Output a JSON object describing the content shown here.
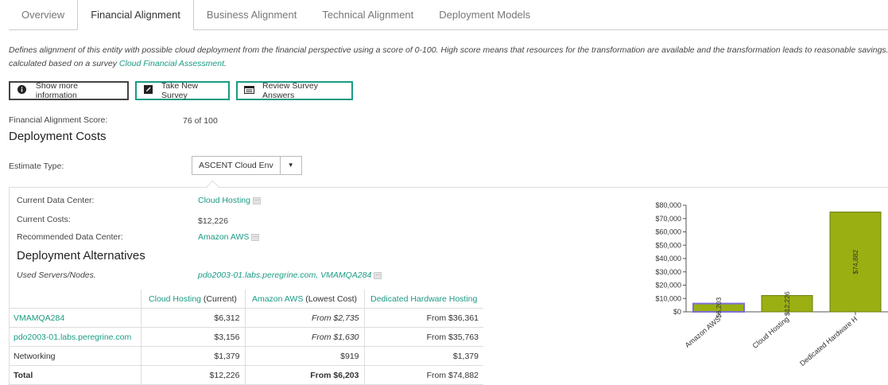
{
  "tabs": [
    {
      "label": "Overview",
      "active": false
    },
    {
      "label": "Financial Alignment",
      "active": true
    },
    {
      "label": "Business Alignment",
      "active": false
    },
    {
      "label": "Technical Alignment",
      "active": false
    },
    {
      "label": "Deployment Models",
      "active": false
    }
  ],
  "description": {
    "line1": "Defines alignment of this entity with possible cloud deployment from the financial perspective using a score of 0-100. High score means that resources for the transformation are available and the transformation leads to reasonable savings.",
    "line2_prefix": "calculated based on a survey ",
    "line2_link": "Cloud Financial Assessment",
    "line2_suffix": "."
  },
  "buttons": {
    "show_more": {
      "label": "Show more information",
      "icon": "info-icon"
    },
    "new_survey": {
      "label": "Take New Survey",
      "icon": "edit-icon"
    },
    "review": {
      "label": "Review Survey Answers",
      "icon": "list-icon"
    }
  },
  "score": {
    "label": "Financial Alignment Score:",
    "value": "76 of 100"
  },
  "deployment_costs": {
    "title": "Deployment Costs"
  },
  "estimate": {
    "label": "Estimate Type:",
    "value": "ASCENT Cloud Env"
  },
  "details": {
    "current_dc_label": "Current Data Center:",
    "current_dc_value": "Cloud Hosting",
    "current_costs_label": "Current Costs:",
    "current_costs_value": "$12,226",
    "recommended_label": "Recommended Data Center:",
    "recommended_value": "Amazon AWS"
  },
  "alternatives": {
    "title": "Deployment Alternatives",
    "used_label": "Used Servers/Nodes.",
    "used_value": "pdo2003-01.labs.peregrine.com, VMAMQA284"
  },
  "table": {
    "headers": [
      {
        "link": "Cloud Hosting",
        "suffix": " (Current)"
      },
      {
        "link": "Amazon AWS",
        "suffix": " (Lowest Cost)"
      },
      {
        "link": "Dedicated Hardware Hosting",
        "suffix": ""
      }
    ],
    "rows": [
      {
        "name": "VMAMQA284",
        "link": true,
        "c1": "$6,312",
        "c2": "From $2,735",
        "c3": "From $36,361"
      },
      {
        "name": "pdo2003-01.labs.peregrine.com",
        "link": true,
        "c1": "$3,156",
        "c2": "From $1,630",
        "c3": "From $35,763"
      },
      {
        "name": "Networking",
        "link": false,
        "c1": "$1,379",
        "c2": "$919",
        "c3": "$1,379"
      },
      {
        "name": "Total",
        "link": false,
        "c1": "$12,226",
        "c2": "From $6,203",
        "c3": "From $74,882"
      }
    ]
  },
  "chart_data": {
    "type": "bar",
    "categories": [
      "Amazon AWS",
      "Cloud Hosting",
      "Dedicated Hardware H"
    ],
    "values": [
      6203,
      12226,
      74882
    ],
    "value_labels": [
      "$6,203",
      "$12,226",
      "$74,882"
    ],
    "yticks": [
      "$0",
      "$10,000",
      "$20,000",
      "$30,000",
      "$40,000",
      "$50,000",
      "$60,000",
      "$70,000",
      "$80,000"
    ],
    "ylim": [
      0,
      80000
    ],
    "colors": {
      "bar": "#9aaf12",
      "bar_border": "#6b7d0a",
      "highlight_border": "#7b6fd6"
    }
  }
}
